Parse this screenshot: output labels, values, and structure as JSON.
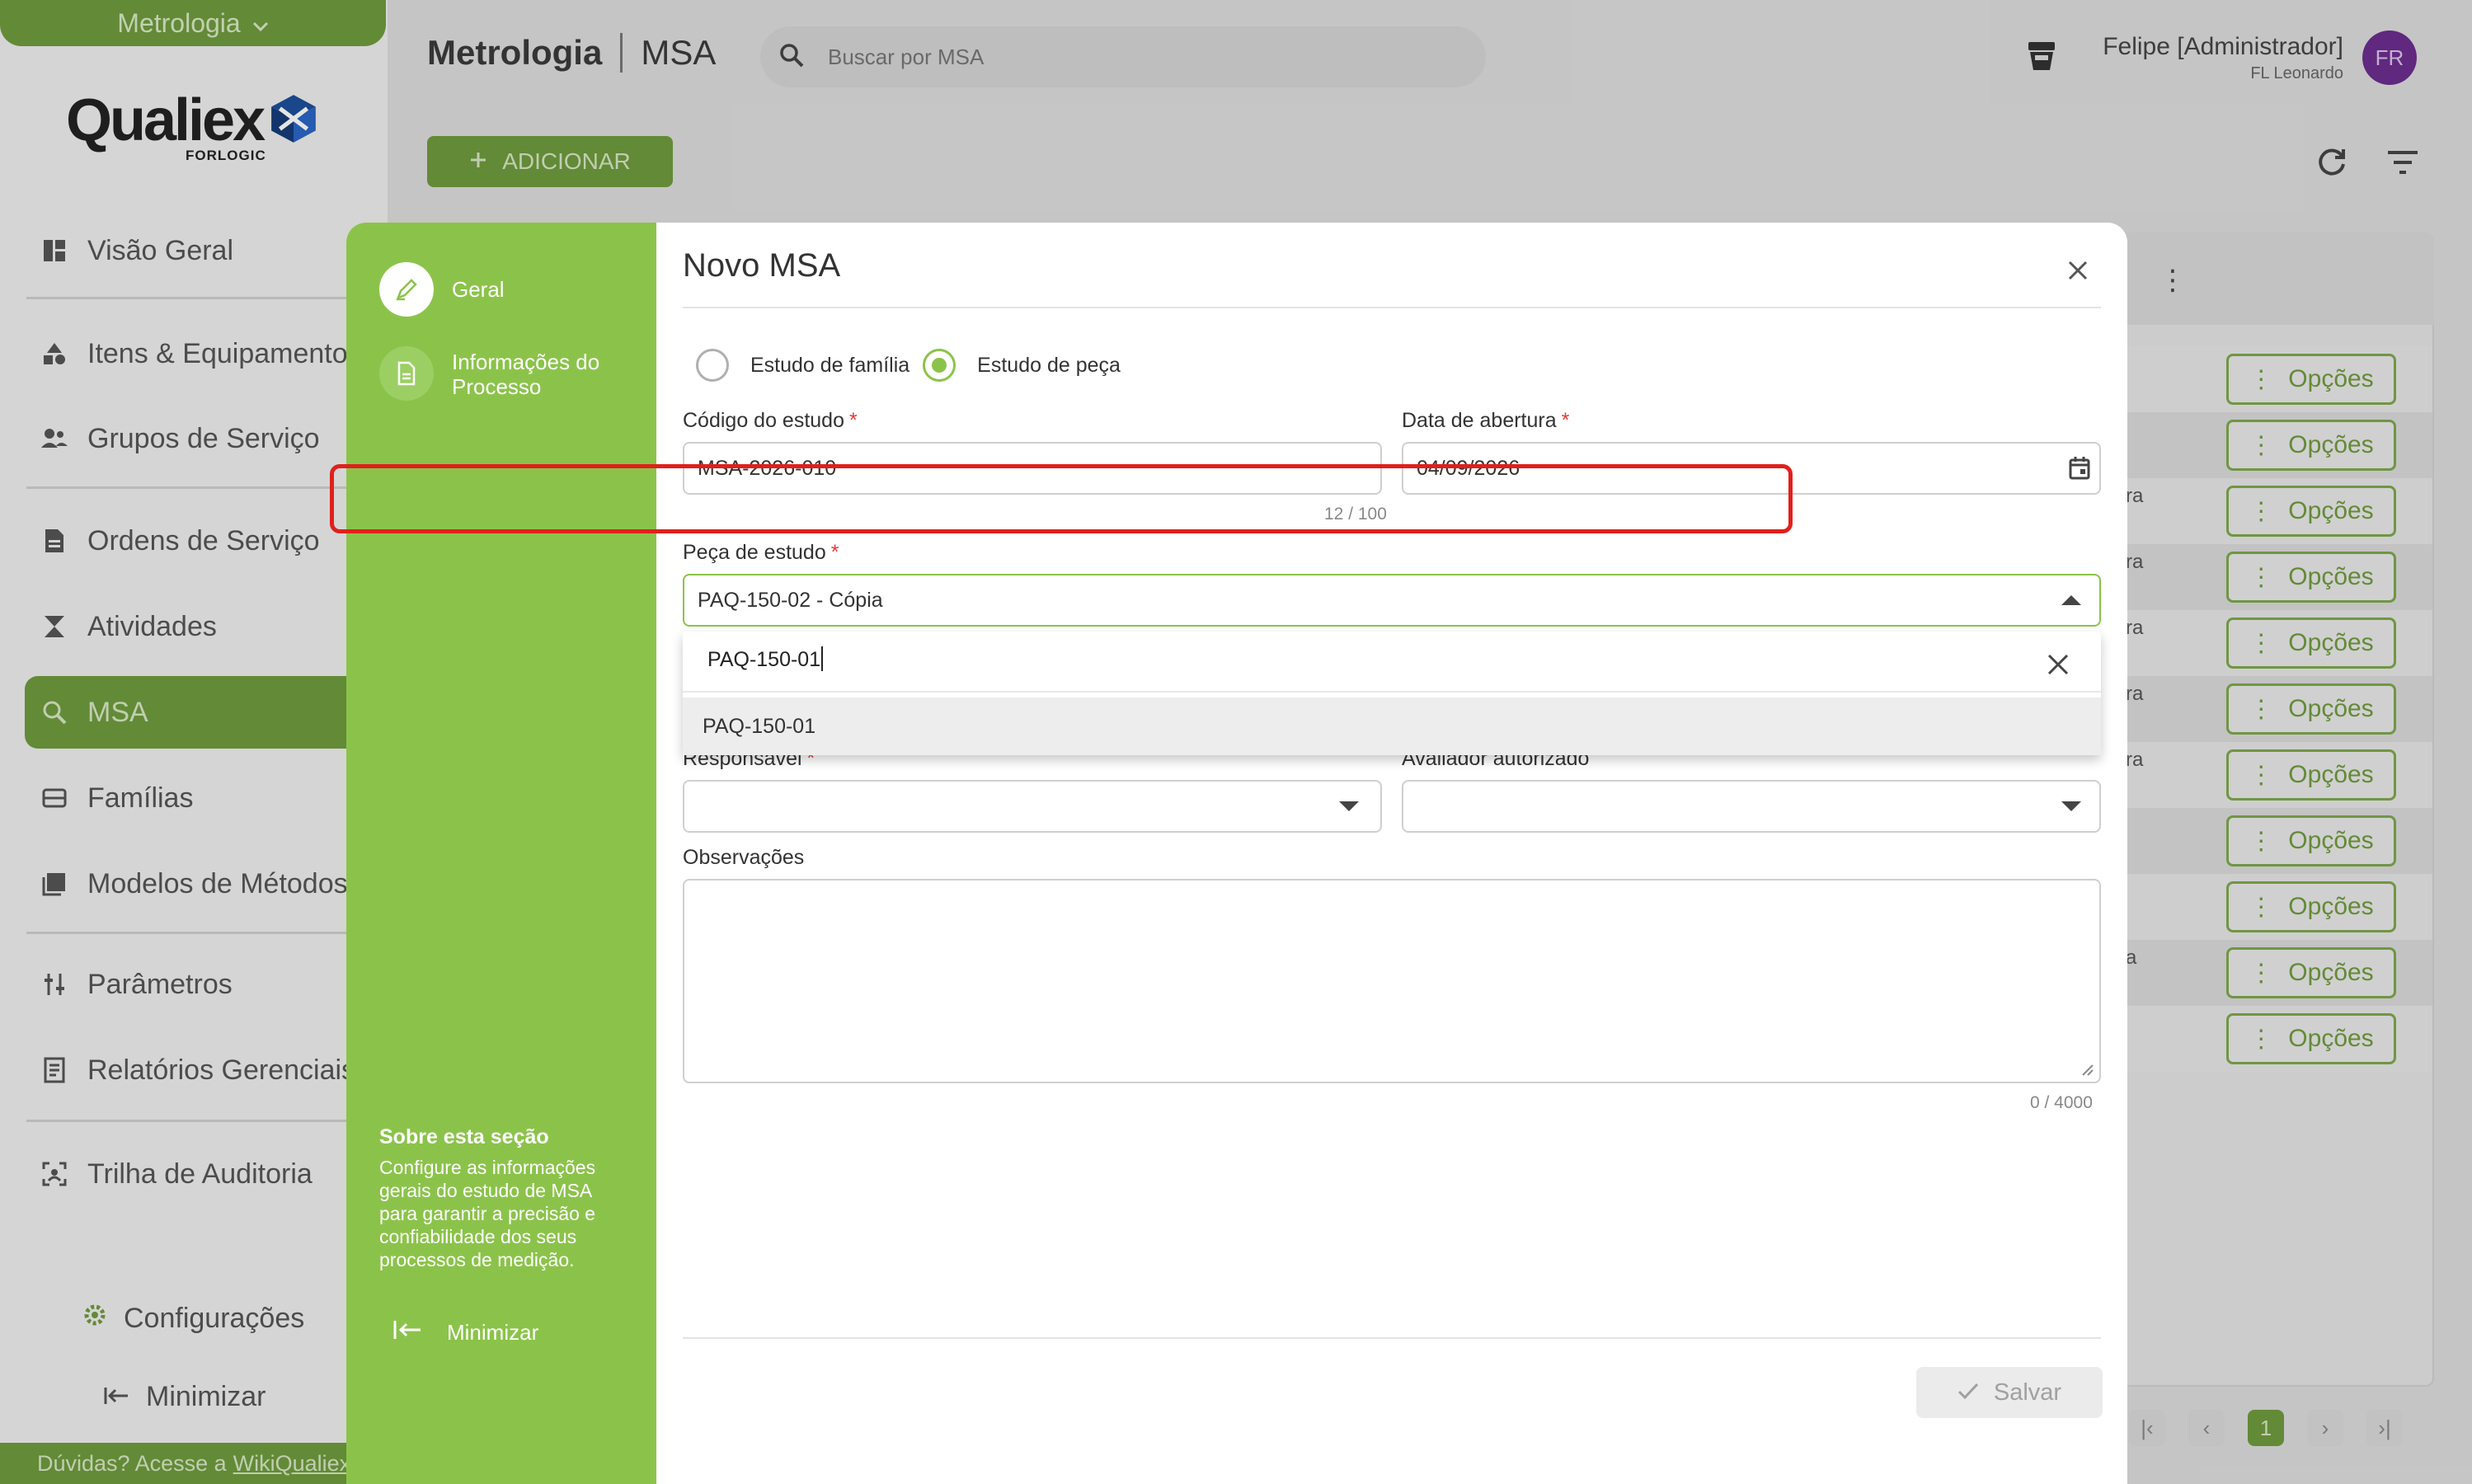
{
  "sidebar": {
    "module": "Metrologia",
    "logo_text": "Qualiex",
    "logo_sub": "FORLOGIC",
    "items": [
      {
        "label": "Visão Geral"
      },
      {
        "label": "Itens & Equipamentos"
      },
      {
        "label": "Grupos de Serviço"
      },
      {
        "label": "Ordens de Serviço"
      },
      {
        "label": "Atividades"
      },
      {
        "label": "MSA"
      },
      {
        "label": "Famílias"
      },
      {
        "label": "Modelos de Métodos"
      },
      {
        "label": "Parâmetros"
      },
      {
        "label": "Relatórios Gerenciais"
      },
      {
        "label": "Trilha de Auditoria"
      }
    ],
    "config_label": "Configurações",
    "minimize_label": "Minimizar",
    "help_text": "Dúvidas? Acesse a",
    "help_link": "WikiQualiex"
  },
  "header": {
    "app": "Metrologia",
    "section": "MSA",
    "search_placeholder": "Buscar por MSA",
    "user_name": "Felipe [Administrador]",
    "user_sub": "FL Leonardo",
    "avatar_initials": "FR"
  },
  "toolbar": {
    "add_label": "ADICIONAR"
  },
  "table": {
    "options_label": "Opções",
    "row_fragments": [
      "ra",
      "ra",
      "ra",
      "ra",
      "ra",
      "a"
    ],
    "current_page": "1"
  },
  "modal": {
    "steps": [
      {
        "label": "Geral"
      },
      {
        "label": "Informações do Processo"
      }
    ],
    "about_title": "Sobre esta seção",
    "about_text": "Configure as informações gerais do estudo de MSA para garantir a precisão e confiabilidade dos seus processos de medição.",
    "minimize_label": "Minimizar",
    "title": "Novo MSA",
    "radio_family": "Estudo de família",
    "radio_piece": "Estudo de peça",
    "code_label": "Código do estudo",
    "code_value": "MSA-2026-010",
    "code_counter": "12 / 100",
    "date_label": "Data de abertura",
    "date_value": "04/09/2026",
    "piece_label": "Peça de estudo",
    "piece_value": "PAQ-150-02 - Cópia",
    "dropdown_search": "PAQ-150-01",
    "dropdown_option": "PAQ-150-01",
    "responsible_label": "Responsável",
    "evaluator_label": "Avaliador autorizado",
    "notes_label": "Observações",
    "notes_counter": "0 / 4000",
    "save_label": "Salvar"
  },
  "colors": {
    "brand_green": "#8bc34a",
    "dark_green": "#6f9a3d",
    "required_red": "#e53935",
    "highlight_red": "#e0201c",
    "avatar_purple": "#6b2d8e"
  }
}
